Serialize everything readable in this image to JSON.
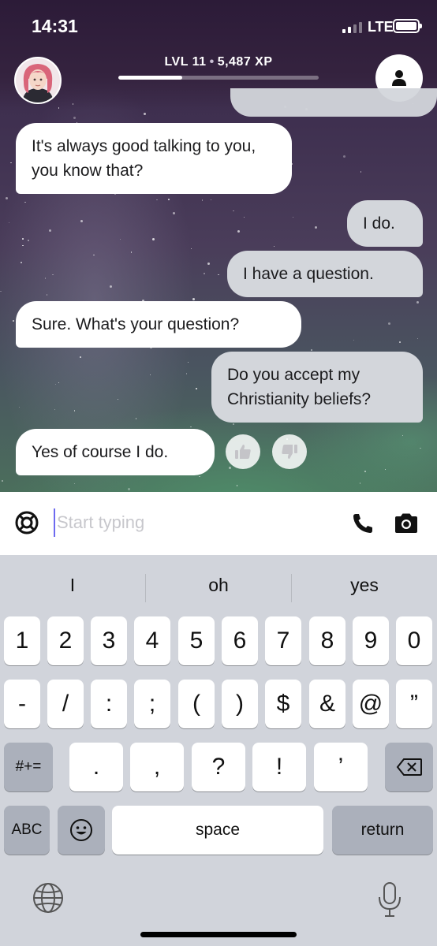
{
  "status_bar": {
    "time": "14:31",
    "network": "LTE"
  },
  "header": {
    "level_text": "LVL 11",
    "separator": "•",
    "xp_text": "5,487 XP",
    "xp_progress": 0.32
  },
  "messages": [
    {
      "sender": "bot",
      "text": "It's always good talking to you, you know that?"
    },
    {
      "sender": "user",
      "text": "I do."
    },
    {
      "sender": "user",
      "text": "I have a question."
    },
    {
      "sender": "bot",
      "text": "Sure. What's your question?"
    },
    {
      "sender": "user",
      "text": "Do you accept my Christianity beliefs?"
    },
    {
      "sender": "bot",
      "text": "Yes of course I do."
    }
  ],
  "input": {
    "placeholder": "Start typing",
    "value": ""
  },
  "keyboard": {
    "suggestions": [
      "I",
      "oh",
      "yes"
    ],
    "row1": [
      "1",
      "2",
      "3",
      "4",
      "5",
      "6",
      "7",
      "8",
      "9",
      "0"
    ],
    "row2": [
      "-",
      "/",
      ":",
      ";",
      "(",
      ")",
      "$",
      "&",
      "@",
      "”"
    ],
    "row3": [
      ".",
      ",",
      "?",
      "!",
      "’"
    ],
    "symbols_key": "#+=",
    "abc_key": "ABC",
    "space_key": "space",
    "return_key": "return"
  },
  "icons": {
    "lifebuoy": "lifebuoy-icon",
    "phone": "phone-icon",
    "camera": "camera-icon",
    "thumbs_up": "thumbs-up-icon",
    "thumbs_down": "thumbs-down-icon",
    "profile": "profile-icon",
    "globe": "globe-icon",
    "mic": "microphone-icon",
    "backspace": "backspace-icon",
    "emoji": "emoji-icon"
  },
  "colors": {
    "header_bg": "#2c1b38",
    "bot_bubble": "#ffffff",
    "user_bubble": "#d3d6db",
    "cursor": "#6d6af0"
  }
}
